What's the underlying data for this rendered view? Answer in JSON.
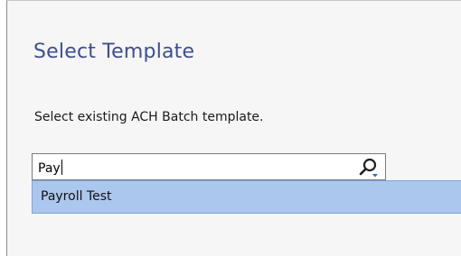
{
  "dialog": {
    "title": "Select Template",
    "description": "Select existing ACH Batch template."
  },
  "search": {
    "value": "Pay",
    "icon": "search-icon"
  },
  "dropdown": {
    "items": [
      {
        "label": "Payroll Test"
      }
    ]
  },
  "colors": {
    "title": "#3d4f8f",
    "highlight": "#acc7ee",
    "highlight_border": "#7fa3d6",
    "icon_accent": "#2a6fc9"
  }
}
